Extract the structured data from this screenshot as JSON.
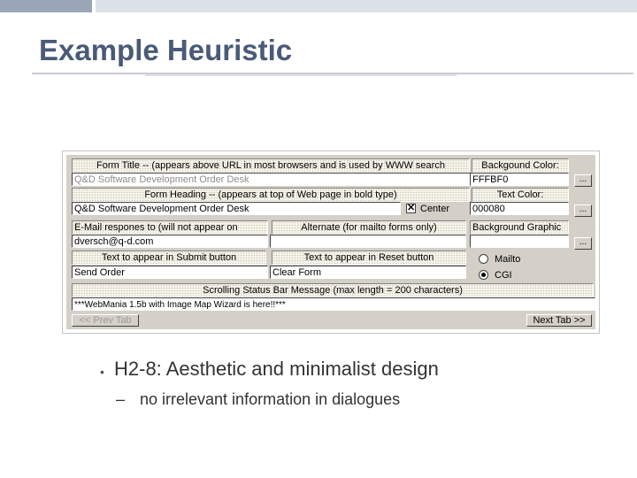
{
  "slide": {
    "title": "Example Heuristic",
    "bullet_main": "H2-8: Aesthetic and minimalist design",
    "bullet_sub": "no irrelevant information in dialogues",
    "bullet_marker": "•",
    "sub_marker": "–"
  },
  "form": {
    "form_title_label": "Form Title -- (appears above URL in most browsers and is used by WWW search",
    "form_title_value": "Q&D Software Development Order Desk",
    "form_heading_label": "Form Heading -- (appears at top of Web page in bold type)",
    "form_heading_value": "Q&D Software Development Order Desk",
    "center_label": "Center",
    "center_checked_mark": "✕",
    "email_label": "E-Mail respones to (will not appear on",
    "email_value": "dversch@q-d.com",
    "alternate_label": "Alternate (for mailto forms only)",
    "alternate_value": "",
    "submit_label": "Text to appear in Submit button",
    "submit_value": "Send Order",
    "reset_label": "Text to appear in Reset button",
    "reset_value": "Clear Form",
    "status_label": "Scrolling Status Bar Message (max length = 200 characters)",
    "status_value": "***WebMania 1.5b with Image Map Wizard is here!!***",
    "bg_color_label": "Backgound Color:",
    "bg_color_value": "FFFBF0",
    "text_color_label": "Text Color:",
    "text_color_value": "000080",
    "bg_graphic_label": "Background Graphic",
    "bg_graphic_value": "",
    "browse_label": "...",
    "radio_mailto": "Mailto",
    "radio_cgi": "CGI",
    "selected_method": "CGI",
    "prev_tab": "<< Prev Tab",
    "next_tab": "Next Tab >>"
  },
  "colors": {
    "title": "#4a5a78",
    "dialog_face": "#d4d0c8",
    "label_bg": "#f7f5ea"
  }
}
